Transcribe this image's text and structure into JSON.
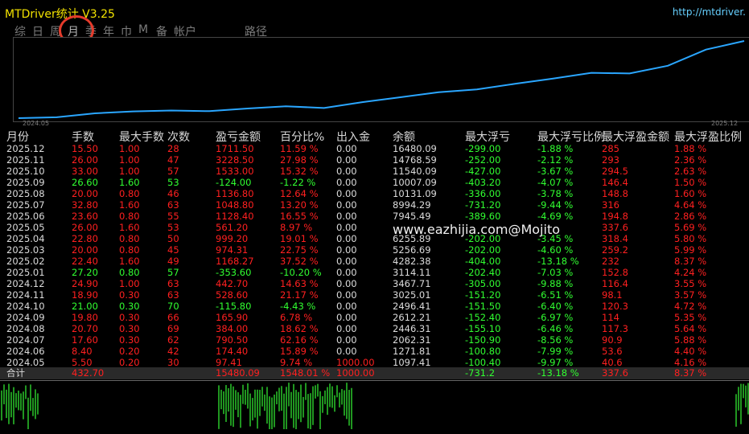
{
  "window": {
    "title": "MTDriver统计  V3.25",
    "url": "http://mtdriver."
  },
  "tabs": [
    {
      "label": "综"
    },
    {
      "label": "日"
    },
    {
      "label": "周"
    },
    {
      "label": "月"
    },
    {
      "label": "季"
    },
    {
      "label": "年"
    },
    {
      "label": "巾"
    },
    {
      "label": "M"
    },
    {
      "label": "备"
    },
    {
      "label": "帐户"
    },
    {
      "label": "路径"
    }
  ],
  "colors": {
    "accent_title": "#f2e200",
    "line": "#2aa6ff",
    "negative": "#ff2020",
    "positive": "#31ff31",
    "highlight_circle": "#e53b2b"
  },
  "chart_data": {
    "type": "line",
    "x_start": "2024.05",
    "x_end": "2025.12",
    "categories": [
      "2024.05",
      "2024.06",
      "2024.07",
      "2024.08",
      "2024.09",
      "2024.10",
      "2024.11",
      "2024.12",
      "2025.01",
      "2025.02",
      "2025.03",
      "2025.04",
      "2025.05",
      "2025.06",
      "2025.07",
      "2025.08",
      "2025.09",
      "2025.10",
      "2025.11",
      "2025.12"
    ],
    "values": [
      1097.41,
      1271.81,
      2062.31,
      2446.31,
      2612.21,
      2496.41,
      3025.01,
      3467.71,
      3114.11,
      4282.38,
      5256.69,
      6255.89,
      6817.5,
      7945.49,
      8994.29,
      10131.09,
      10007.09,
      11540.09,
      14768.59,
      16480.09
    ]
  },
  "table": {
    "headers": [
      "月份",
      "手数",
      "最大手数",
      "次数",
      "盈亏金额",
      "百分比%",
      "出入金",
      "余额",
      "最大浮亏",
      "最大浮亏比例",
      "最大浮盈金额",
      "最大浮盈比例"
    ],
    "rows": [
      [
        "2025.12",
        "15.50",
        "1.00",
        "28",
        "1711.50",
        "11.59 %",
        "0.00",
        "16480.09",
        "-299.00",
        "-1.88 %",
        "285",
        "1.88 %"
      ],
      [
        "2025.11",
        "26.00",
        "1.00",
        "47",
        "3228.50",
        "27.98 %",
        "0.00",
        "14768.59",
        "-252.00",
        "-2.12 %",
        "293",
        "2.36 %"
      ],
      [
        "2025.10",
        "33.00",
        "1.00",
        "57",
        "1533.00",
        "15.32 %",
        "0.00",
        "11540.09",
        "-427.00",
        "-3.67 %",
        "294.5",
        "2.63 %"
      ],
      [
        "2025.09",
        "26.60",
        "1.60",
        "53",
        "-124.00",
        "-1.22 %",
        "0.00",
        "10007.09",
        "-403.20",
        "-4.07 %",
        "146.4",
        "1.50 %"
      ],
      [
        "2025.08",
        "20.00",
        "0.80",
        "46",
        "1136.80",
        "12.64 %",
        "0.00",
        "10131.09",
        "-336.00",
        "-3.78 %",
        "148.8",
        "1.60 %"
      ],
      [
        "2025.07",
        "32.80",
        "1.60",
        "63",
        "1048.80",
        "13.20 %",
        "0.00",
        "8994.29",
        "-731.20",
        "-9.44 %",
        "316",
        "4.64 %"
      ],
      [
        "2025.06",
        "23.60",
        "0.80",
        "55",
        "1128.40",
        "16.55 %",
        "0.00",
        "7945.49",
        "-389.60",
        "-4.69 %",
        "194.8",
        "2.86 %"
      ],
      [
        "2025.05",
        "26.00",
        "1.60",
        "53",
        "561.20",
        "8.97 %",
        "0.00",
        "",
        "",
        "",
        "337.6",
        "5.69 %"
      ],
      [
        "2025.04",
        "22.80",
        "0.80",
        "50",
        "999.20",
        "19.01 %",
        "0.00",
        "6255.89",
        "-202.00",
        "-3.45 %",
        "318.4",
        "5.80 %"
      ],
      [
        "2025.03",
        "20.00",
        "0.80",
        "45",
        "974.31",
        "22.75 %",
        "0.00",
        "5256.69",
        "-202.00",
        "-4.60 %",
        "259.2",
        "5.99 %"
      ],
      [
        "2025.02",
        "22.40",
        "1.60",
        "49",
        "1168.27",
        "37.52 %",
        "0.00",
        "4282.38",
        "-404.00",
        "-13.18 %",
        "232",
        "8.37 %"
      ],
      [
        "2025.01",
        "27.20",
        "0.80",
        "57",
        "-353.60",
        "-10.20 %",
        "0.00",
        "3114.11",
        "-202.40",
        "-7.03 %",
        "152.8",
        "4.24 %"
      ],
      [
        "2024.12",
        "24.90",
        "1.00",
        "63",
        "442.70",
        "14.63 %",
        "0.00",
        "3467.71",
        "-305.00",
        "-9.88 %",
        "116.4",
        "3.55 %"
      ],
      [
        "2024.11",
        "18.90",
        "0.30",
        "63",
        "528.60",
        "21.17 %",
        "0.00",
        "3025.01",
        "-151.20",
        "-6.51 %",
        "98.1",
        "3.57 %"
      ],
      [
        "2024.10",
        "21.00",
        "0.30",
        "70",
        "-115.80",
        "-4.43 %",
        "0.00",
        "2496.41",
        "-151.50",
        "-6.40 %",
        "120.3",
        "4.72 %"
      ],
      [
        "2024.09",
        "19.80",
        "0.30",
        "66",
        "165.90",
        "6.78 %",
        "0.00",
        "2612.21",
        "-152.40",
        "-6.97 %",
        "114",
        "5.35 %"
      ],
      [
        "2024.08",
        "20.70",
        "0.30",
        "69",
        "384.00",
        "18.62 %",
        "0.00",
        "2446.31",
        "-155.10",
        "-6.46 %",
        "117.3",
        "5.64 %"
      ],
      [
        "2024.07",
        "17.60",
        "0.30",
        "62",
        "790.50",
        "62.16 %",
        "0.00",
        "2062.31",
        "-150.90",
        "-8.56 %",
        "90.9",
        "5.88 %"
      ],
      [
        "2024.06",
        "8.40",
        "0.20",
        "42",
        "174.40",
        "15.89 %",
        "0.00",
        "1271.81",
        "-100.80",
        "-7.99 %",
        "53.6",
        "4.40 %"
      ],
      [
        "2024.05",
        "5.50",
        "0.20",
        "30",
        "97.41",
        "9.74 %",
        "1000.00",
        "1097.41",
        "-100.40",
        "-9.97 %",
        "40.6",
        "4.16 %"
      ]
    ],
    "total": [
      "合计",
      "432.70",
      "",
      "",
      "15480.09",
      "1548.01 %",
      "1000.00",
      "",
      "-731.2",
      "-13.18 %",
      "337.6",
      "8.37 %"
    ]
  },
  "watermark": "www.eazhijia.com@Mojito"
}
